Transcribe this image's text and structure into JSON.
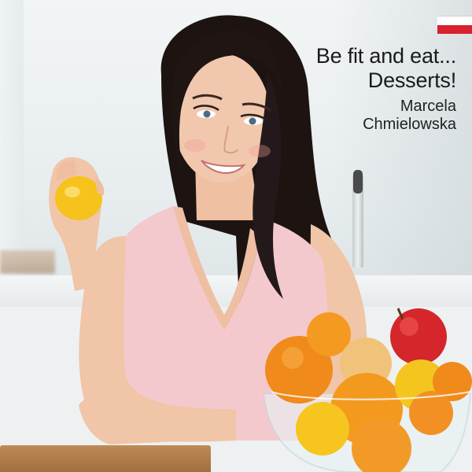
{
  "cover": {
    "title_line1": "Be fit and eat...",
    "title_line2": "Desserts!",
    "author_first": "Marcela",
    "author_last": "Chmielowska",
    "flag_icon": "poland-flag-icon",
    "colors": {
      "flag_red": "#d8202f",
      "flag_white": "#ffffff",
      "top_pink": "#f2c7cc",
      "fruit_orange": "#f08a1a"
    }
  }
}
